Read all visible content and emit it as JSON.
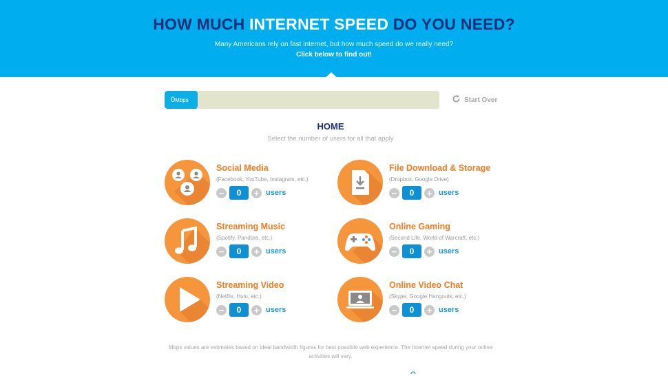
{
  "header": {
    "title_part1": "HOW MUCH ",
    "title_highlight": "INTERNET SPEED",
    "title_part2": " DO YOU NEED?",
    "subtitle": "Many Americans rely on fast internet, but how much speed do we really need?",
    "cta": "Click below to find out!"
  },
  "meter": {
    "value": "0",
    "unit": "Mbps",
    "start_over_label": "Start Over"
  },
  "section": {
    "title": "HOME",
    "subtitle": "Select the number of users for all that apply"
  },
  "cards": [
    {
      "title": "Social Media",
      "desc": "(Facebook, YouTube, Instagram, etc.)",
      "count": "0",
      "users_label": "users",
      "icon": "social-users-icon"
    },
    {
      "title": "File Download & Storage",
      "desc": "(Dropbox, Google Drive)",
      "count": "0",
      "users_label": "users",
      "icon": "download-file-icon"
    },
    {
      "title": "Streaming Music",
      "desc": "(Spotify, Pandora, etc.)",
      "count": "0",
      "users_label": "users",
      "icon": "music-note-icon"
    },
    {
      "title": "Online Gaming",
      "desc": "(Second Life, World of Warcraft, etc.)",
      "count": "0",
      "users_label": "users",
      "icon": "gamepad-icon"
    },
    {
      "title": "Streaming Video",
      "desc": "(Netflix, Hulu, etc.)",
      "count": "0",
      "users_label": "users",
      "icon": "play-icon"
    },
    {
      "title": "Online Video Chat",
      "desc": "(Skype, Google Hangouts, etc.)",
      "count": "0",
      "users_label": "users",
      "icon": "video-chat-icon"
    }
  ],
  "controls": {
    "minus": "−",
    "plus": "+"
  },
  "footnote": "Mbps values are estimates based on ideal bandwidth figures for best possible web experience. The Internet speed during your online activities will vary.",
  "colors": {
    "header_bg": "#00aeef",
    "title_dark": "#1a2f7a",
    "accent_orange": "#f47b20",
    "icon_orange": "#f5963c",
    "counter_blue": "#0f8fd4"
  }
}
